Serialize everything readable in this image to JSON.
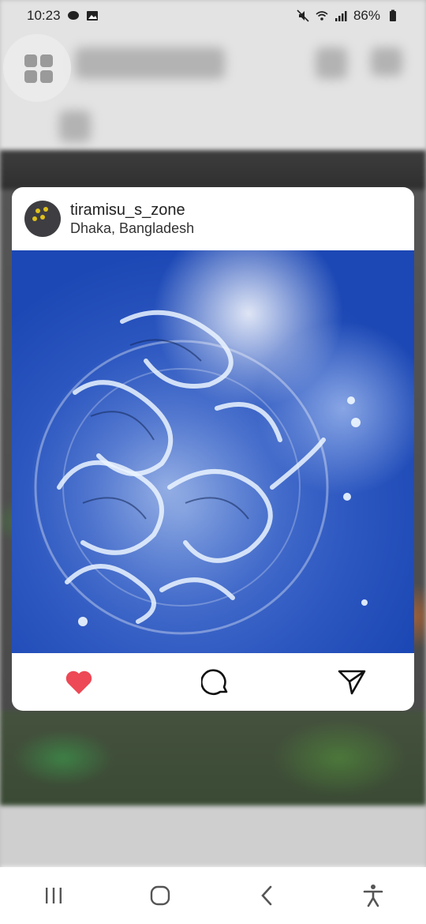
{
  "status_bar": {
    "time": "10:23",
    "battery": "86%"
  },
  "post": {
    "username": "tiramisu_s_zone",
    "location": "Dhaka, Bangladesh",
    "liked": true,
    "accent_like_color": "#ed4956",
    "image_description": "water splash"
  },
  "icons": {
    "like": "heart-icon",
    "comment": "comment-icon",
    "share": "send-icon",
    "grid": "grid-icon"
  },
  "nav_bar": {
    "recents": "recents-icon",
    "home": "home-icon",
    "back": "back-icon",
    "accessibility": "accessibility-icon"
  }
}
